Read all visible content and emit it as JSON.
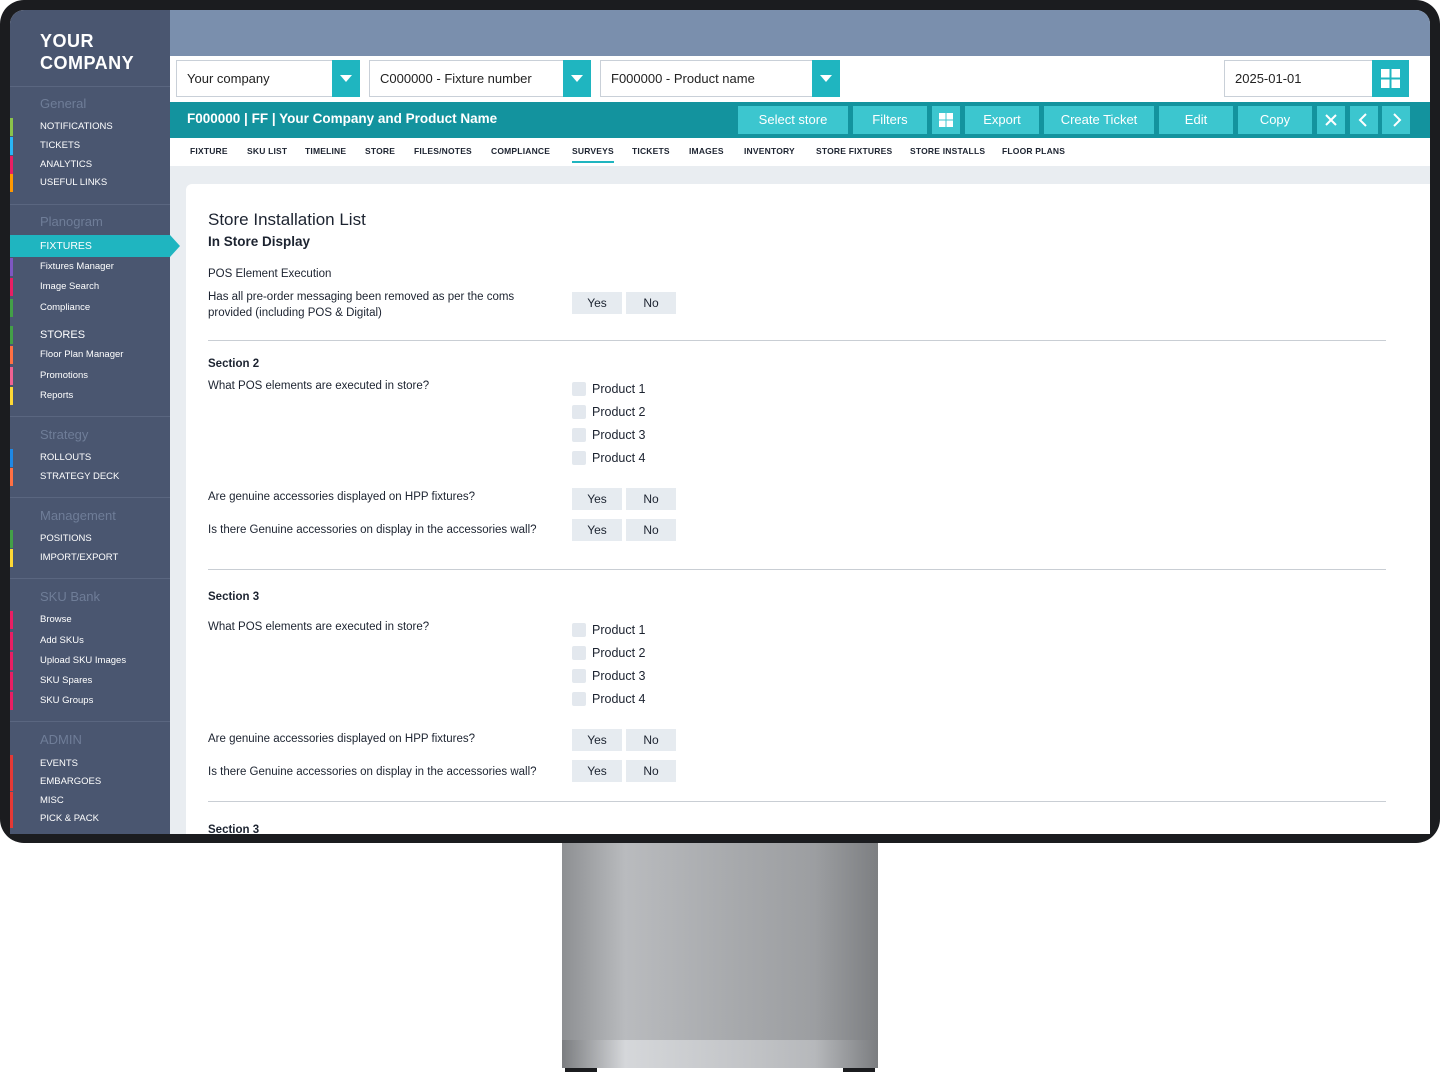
{
  "sidebar": {
    "logo_line1": "YOUR",
    "logo_line2": "COMPANY",
    "groups": {
      "general": "General",
      "planogram": "Planogram",
      "strategy": "Strategy",
      "management": "Management",
      "sku_bank": "SKU Bank",
      "admin": "ADMIN"
    },
    "items": {
      "notifications": "NOTIFICATIONS",
      "tickets": "TICKETS",
      "analytics": "ANALYTICS",
      "useful_links": "USEFUL LINKS",
      "fixtures": "FIXTURES",
      "fixtures_manager": "Fixtures Manager",
      "image_search": "Image Search",
      "compliance": "Compliance",
      "stores": "STORES",
      "floor_plan_manager": "Floor Plan Manager",
      "promotions": "Promotions",
      "reports": "Reports",
      "rollouts": "ROLLOUTS",
      "strategy_deck": "STRATEGY DECK",
      "positions": "POSITIONS",
      "import_export": "IMPORT/EXPORT",
      "browse": "Browse",
      "add_skus": "Add SKUs",
      "upload_sku_images": "Upload SKU Images",
      "sku_spares": "SKU Spares",
      "sku_groups": "SKU Groups",
      "events": "EVENTS",
      "embargoes": "EMBARGOES",
      "misc": "MISC",
      "pick_pack": "PICK & PACK"
    }
  },
  "selectors": {
    "company": "Your company",
    "fixture": "C000000 - Fixture number",
    "product": "F000000 - Product name",
    "date": "2025-01-01"
  },
  "fixture_bar": {
    "title": "F000000 | FF | Your Company and Product Name",
    "select_store": "Select store",
    "filters": "Filters",
    "export": "Export",
    "create_ticket": "Create Ticket",
    "edit": "Edit",
    "copy": "Copy"
  },
  "tabs": [
    "FIXTURE",
    "SKU LIST",
    "TIMELINE",
    "STORE",
    "FILES/NOTES",
    "COMPLIANCE",
    "SURVEYS",
    "TICKETS",
    "IMAGES",
    "INVENTORY",
    "STORE FIXTURES",
    "STORE INSTALLS",
    "FLOOR PLANS"
  ],
  "active_tab": "SURVEYS",
  "content": {
    "title": "Store Installation List",
    "subtitle": "In Store Display",
    "s1_heading": "POS Element Execution",
    "s1_q1": "Has all pre-order messaging been removed as per the coms provided (including POS & Digital)",
    "yes": "Yes",
    "no": "No",
    "s2_heading": "Section 2",
    "s2_q1": "What POS elements are executed in store?",
    "s2_q2": "Are genuine accessories displayed on HPP fixtures?",
    "s2_q3": "Is there Genuine accessories on display in the accessories wall?",
    "s3_heading": "Section 3",
    "s3_q1": "What POS elements are executed in store?",
    "s3_q2": "Are genuine accessories displayed on HPP fixtures?",
    "s3_q3": "Is there Genuine accessories on display in the accessories wall?",
    "s4_heading": "Section 3",
    "products": [
      "Product 1",
      "Product 2",
      "Product 3",
      "Product 4"
    ]
  },
  "colors": {
    "accent": "#1fb5c0",
    "fixture_bar": "#13939e",
    "sidebar": "#4a5670",
    "topband": "#7a8fad"
  }
}
